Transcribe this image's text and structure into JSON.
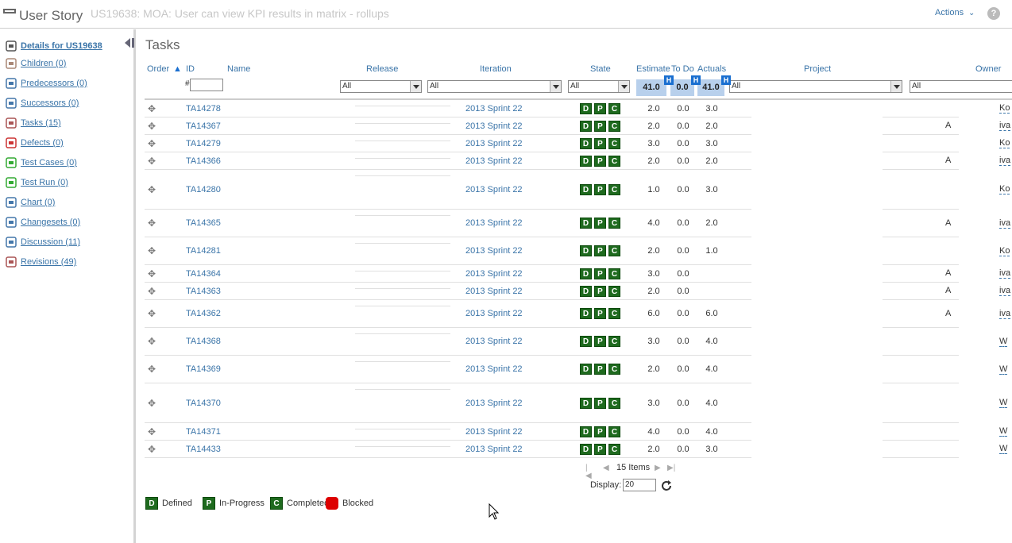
{
  "header": {
    "title": "User Story",
    "subtitle": "US19638: MOA: User can view KPI results in matrix - rollups",
    "actions_label": "Actions"
  },
  "sidebar": {
    "items": [
      {
        "label": "Details for US19638",
        "icon": "details-icon"
      },
      {
        "label": "Children (0)",
        "icon": "children-icon"
      },
      {
        "label": "Predecessors (0)",
        "icon": "predecessors-icon"
      },
      {
        "label": "Successors (0)",
        "icon": "successors-icon"
      },
      {
        "label": "Tasks (15)",
        "icon": "tasks-icon"
      },
      {
        "label": "Defects (0)",
        "icon": "defects-icon"
      },
      {
        "label": "Test Cases (0)",
        "icon": "test-cases-icon"
      },
      {
        "label": "Test Run (0)",
        "icon": "test-run-icon"
      },
      {
        "label": "Chart (0)",
        "icon": "chart-icon"
      },
      {
        "label": "Changesets (0)",
        "icon": "changesets-icon"
      },
      {
        "label": "Discussion (11)",
        "icon": "discussion-icon"
      },
      {
        "label": "Revisions (49)",
        "icon": "revisions-icon"
      }
    ]
  },
  "main": {
    "title": "Tasks",
    "columns": {
      "order": "Order",
      "id": "ID",
      "name": "Name",
      "release": "Release",
      "iteration": "Iteration",
      "state": "State",
      "estimate": "Estimate",
      "todo": "To Do",
      "actuals": "Actuals",
      "project": "Project",
      "owner": "Owner"
    },
    "filters": {
      "order_hash": "#",
      "release": "All",
      "iteration": "All",
      "state": "All",
      "project": "All",
      "owner": "All"
    },
    "totals": {
      "estimate": "41.0",
      "todo": "0.0",
      "actuals": "41.0",
      "badge": "H"
    },
    "rows": [
      {
        "id": "TA14278",
        "iteration": "2013 Sprint 22",
        "estimate": "2.0",
        "todo": "0.0",
        "actuals": "3.0",
        "project": "",
        "owner": "Ko"
      },
      {
        "id": "TA14367",
        "iteration": "2013 Sprint 22",
        "estimate": "2.0",
        "todo": "0.0",
        "actuals": "2.0",
        "project": "A",
        "owner": "iva"
      },
      {
        "id": "TA14279",
        "iteration": "2013 Sprint 22",
        "estimate": "3.0",
        "todo": "0.0",
        "actuals": "3.0",
        "project": "",
        "owner": "Ko"
      },
      {
        "id": "TA14366",
        "iteration": "2013 Sprint 22",
        "estimate": "2.0",
        "todo": "0.0",
        "actuals": "2.0",
        "project": "A",
        "owner": "iva"
      },
      {
        "id": "TA14280",
        "iteration": "2013 Sprint 22",
        "estimate": "1.0",
        "todo": "0.0",
        "actuals": "3.0",
        "project": "",
        "owner": "Ko"
      },
      {
        "id": "TA14365",
        "iteration": "2013 Sprint 22",
        "estimate": "4.0",
        "todo": "0.0",
        "actuals": "2.0",
        "project": "A",
        "owner": "iva"
      },
      {
        "id": "TA14281",
        "iteration": "2013 Sprint 22",
        "estimate": "2.0",
        "todo": "0.0",
        "actuals": "1.0",
        "project": "",
        "owner": "Ko"
      },
      {
        "id": "TA14364",
        "iteration": "2013 Sprint 22",
        "estimate": "3.0",
        "todo": "0.0",
        "actuals": "",
        "project": "A",
        "owner": "iva"
      },
      {
        "id": "TA14363",
        "iteration": "2013 Sprint 22",
        "estimate": "2.0",
        "todo": "0.0",
        "actuals": "",
        "project": "A",
        "owner": "iva"
      },
      {
        "id": "TA14362",
        "iteration": "2013 Sprint 22",
        "estimate": "6.0",
        "todo": "0.0",
        "actuals": "6.0",
        "project": "A",
        "owner": "iva"
      },
      {
        "id": "TA14368",
        "iteration": "2013 Sprint 22",
        "estimate": "3.0",
        "todo": "0.0",
        "actuals": "4.0",
        "project": "",
        "owner": "W"
      },
      {
        "id": "TA14369",
        "iteration": "2013 Sprint 22",
        "estimate": "2.0",
        "todo": "0.0",
        "actuals": "4.0",
        "project": "",
        "owner": "W"
      },
      {
        "id": "TA14370",
        "iteration": "2013 Sprint 22",
        "estimate": "3.0",
        "todo": "0.0",
        "actuals": "4.0",
        "project": "",
        "owner": "W"
      },
      {
        "id": "TA14371",
        "iteration": "2013 Sprint 22",
        "estimate": "4.0",
        "todo": "0.0",
        "actuals": "4.0",
        "project": "",
        "owner": "W"
      },
      {
        "id": "TA14433",
        "iteration": "2013 Sprint 22",
        "estimate": "2.0",
        "todo": "0.0",
        "actuals": "3.0",
        "project": "",
        "owner": "W"
      }
    ],
    "state_letters": [
      "D",
      "P",
      "C"
    ],
    "pager": {
      "items_label": "15 Items",
      "display_label": "Display:",
      "display_value": "20"
    },
    "legend": {
      "defined_letter": "D",
      "defined": "Defined",
      "inprogress_letter": "P",
      "inprogress": "In-Progress",
      "completed_letter": "C",
      "completed": "Completed",
      "blocked": "Blocked"
    }
  },
  "colors": {
    "accent": "#3a74a8",
    "state_green": "#1e6a1e",
    "totals_bg": "#b8d0ec",
    "badge_blue": "#1a6fd0",
    "blocked_red": "#dd0000"
  }
}
